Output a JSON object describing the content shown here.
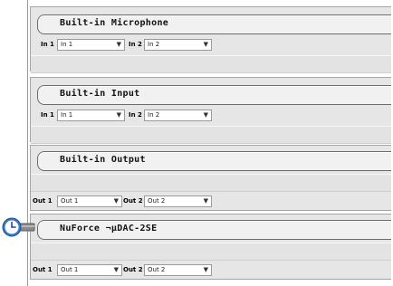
{
  "devices": [
    {
      "name": "Built-in Microphone",
      "channels": [
        {
          "label": "In 1",
          "value": "In 1"
        },
        {
          "label": "In 2",
          "value": "In 2"
        }
      ]
    },
    {
      "name": "Built-in Input",
      "channels": [
        {
          "label": "In 1",
          "value": "In 1"
        },
        {
          "label": "In 2",
          "value": "In 2"
        }
      ]
    },
    {
      "name": "Built-in Output",
      "channels": [
        {
          "label": "Out 1",
          "value": "Out 1"
        },
        {
          "label": "Out 2",
          "value": "Out 2"
        }
      ]
    },
    {
      "name": "NuForce ¬µDAC-2SE",
      "channels": [
        {
          "label": "Out 1",
          "value": "Out 1"
        },
        {
          "label": "Out 2",
          "value": "Out 2"
        }
      ]
    }
  ],
  "icons": {
    "dropdown": "chevron-down-icon",
    "status": "clock-icon"
  },
  "colors": {
    "panel_bg": "#e6e6e6",
    "header_bg": "#f1f1f1",
    "clock_blue": "#3a78c8"
  }
}
